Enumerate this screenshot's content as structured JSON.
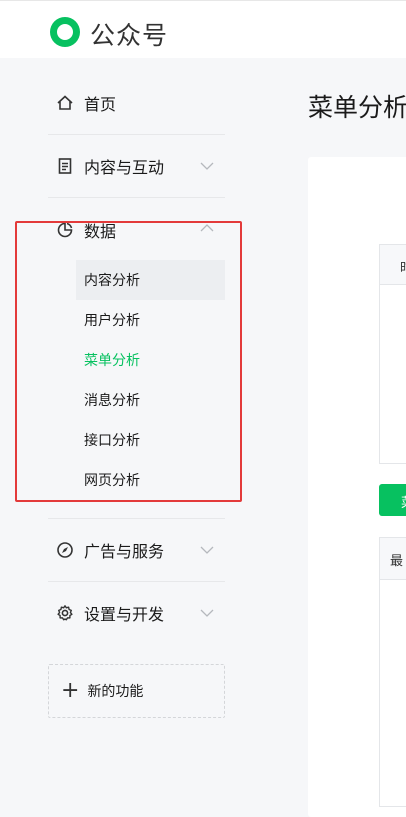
{
  "header": {
    "brand": "公众号"
  },
  "sidebar": {
    "items": [
      {
        "label": "首页"
      },
      {
        "label": "内容与互动"
      },
      {
        "label": "数据"
      },
      {
        "label": "广告与服务"
      },
      {
        "label": "设置与开发"
      }
    ],
    "data_subitems": [
      {
        "label": "内容分析"
      },
      {
        "label": "用户分析"
      },
      {
        "label": "菜单分析"
      },
      {
        "label": "消息分析"
      },
      {
        "label": "接口分析"
      },
      {
        "label": "网页分析"
      }
    ],
    "new_feature": "新的功能"
  },
  "main": {
    "title": "菜单分析",
    "table1_header_partial": "时",
    "button_partial": "菜",
    "table2_header_partial": "最"
  },
  "colors": {
    "accent": "#07c160",
    "highlight_border": "#e33a3a"
  },
  "icons": [
    "logo-icon",
    "home-icon",
    "document-icon",
    "pie-chart-icon",
    "compass-icon",
    "gear-icon",
    "chevron-down-icon",
    "chevron-up-icon",
    "plus-icon"
  ]
}
